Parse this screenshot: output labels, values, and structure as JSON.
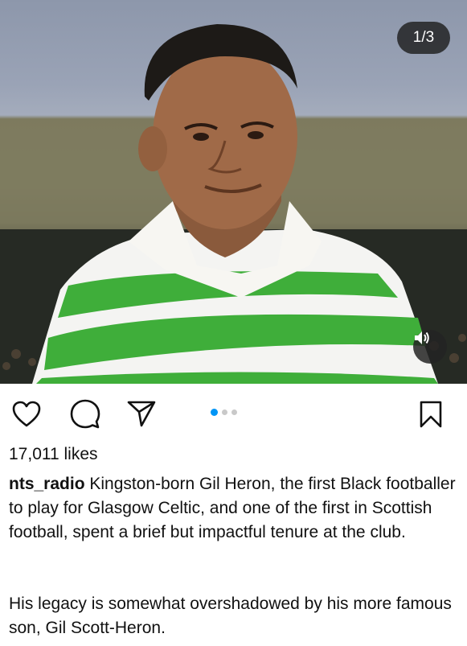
{
  "post": {
    "carousel_counter": "1/3",
    "carousel_total": 3,
    "carousel_index": 1,
    "likes": "17,011 likes",
    "username": "nts_radio",
    "caption_p1": "Kingston-born Gil Heron, the first Black footballer to play for Glasgow Celtic, and one of the first in Scottish football, spent a brief but impactful tenure at the club.",
    "caption_p2": "His legacy is somewhat overshadowed by his more famous son, Gil Scott-Heron."
  },
  "icons": {
    "like": "heart-icon",
    "comment": "comment-icon",
    "share": "send-icon",
    "save": "bookmark-icon",
    "sound": "speaker-icon"
  },
  "colors": {
    "active_dot": "#0095f6",
    "jersey_green": "#3fae3a"
  }
}
